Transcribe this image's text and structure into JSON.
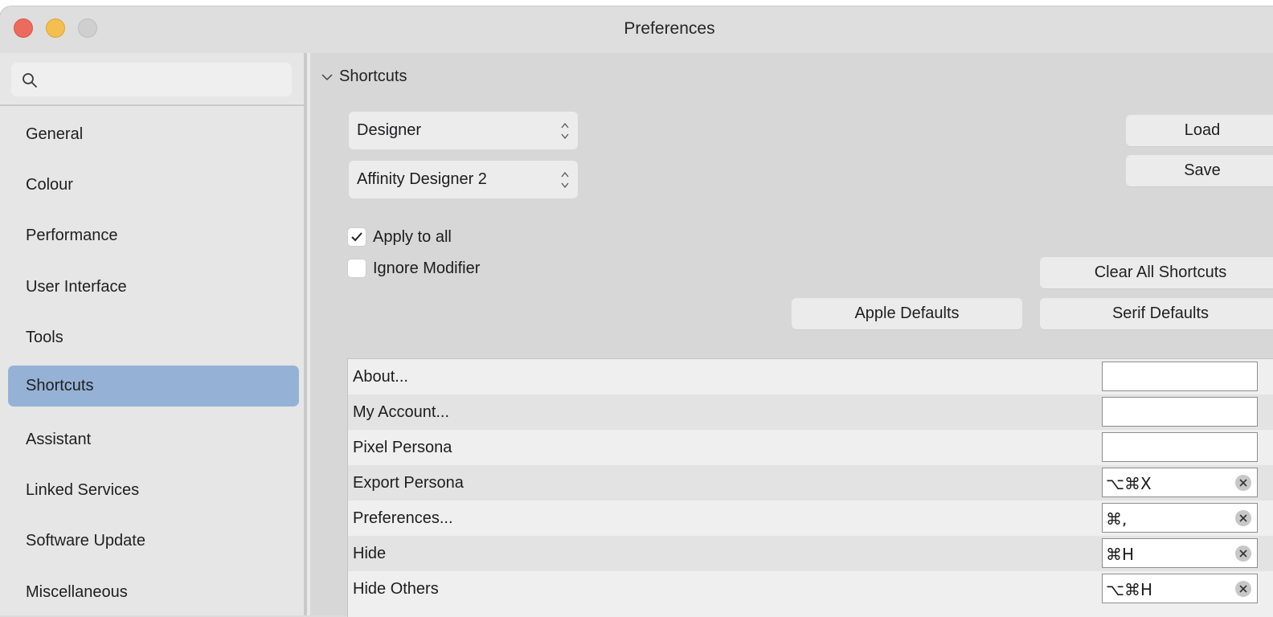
{
  "window": {
    "title": "Preferences"
  },
  "sidebar": {
    "search_placeholder": "",
    "items": [
      {
        "label": "General"
      },
      {
        "label": "Colour"
      },
      {
        "label": "Performance"
      },
      {
        "label": "User Interface"
      },
      {
        "label": "Tools"
      },
      {
        "label": "Shortcuts",
        "selected": true
      },
      {
        "label": "Assistant"
      },
      {
        "label": "Linked Services"
      },
      {
        "label": "Software Update"
      },
      {
        "label": "Miscellaneous"
      }
    ]
  },
  "main": {
    "section_title": "Shortcuts",
    "popup_app": "Designer",
    "popup_preset": "Affinity Designer 2",
    "load_label": "Load",
    "save_label": "Save",
    "apply_to_all": {
      "label": "Apply to all",
      "checked": true
    },
    "ignore_modifier": {
      "label": "Ignore Modifier",
      "checked": false
    },
    "clear_all_label": "Clear All Shortcuts",
    "apple_defaults_label": "Apple Defaults",
    "serif_defaults_label": "Serif Defaults",
    "shortcuts": [
      {
        "name": "About...",
        "keys": ""
      },
      {
        "name": "My Account...",
        "keys": ""
      },
      {
        "name": "Pixel Persona",
        "keys": ""
      },
      {
        "name": "Export Persona",
        "keys": "⌥⌘X"
      },
      {
        "name": "Preferences...",
        "keys": "⌘,"
      },
      {
        "name": "Hide",
        "keys": "⌘H"
      },
      {
        "name": "Hide Others",
        "keys": "⌥⌘H"
      }
    ]
  },
  "colors": {
    "selection": "#95b2d6",
    "close": "#ed6a5e",
    "minimize": "#f5bf4f"
  }
}
